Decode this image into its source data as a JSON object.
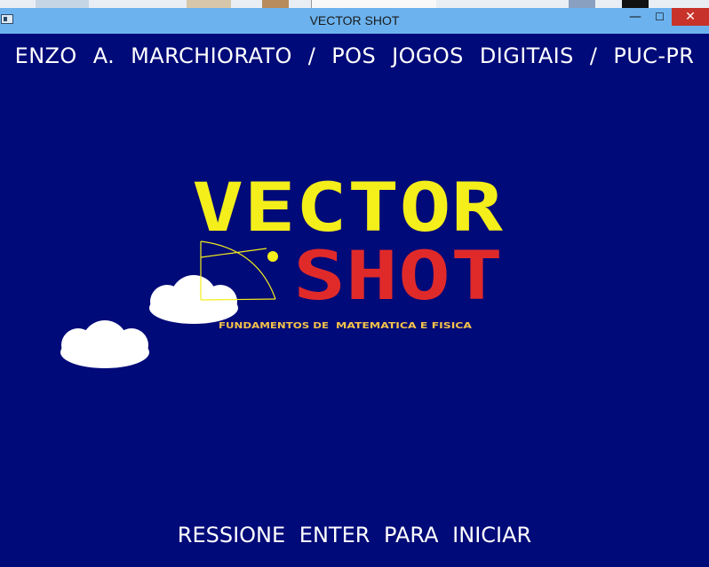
{
  "window": {
    "title": "VECTOR SHOT",
    "minimize_symbol": "—",
    "maximize_symbol": "☐",
    "close_symbol": "✕"
  },
  "screen": {
    "credits": "ENZO A. MARCHIORATO / POS JOGOS DIGITAIS / PUC-PR",
    "logo_word_1": "VECTOR",
    "logo_word_2": "SHOT",
    "subtitle_part_1": "FUNDAMENTOS DE",
    "subtitle_part_2": "MATEMATICA E FISICA",
    "prompt": "RESSIONE ENTER PARA INICIAR"
  },
  "icons": {
    "app": "window-app-icon",
    "bow": "bow-and-arrow-icon",
    "ball": "projectile-ball-icon",
    "clouds": "cloud-icon"
  },
  "colors": {
    "background": "#000a78",
    "titlebar": "#6cb2ee",
    "close_button": "#c7332a",
    "logo_vector": "#f4ee1a",
    "logo_shot": "#e02a2a",
    "subtitle": "#f5c24a",
    "text": "#ffffff"
  }
}
